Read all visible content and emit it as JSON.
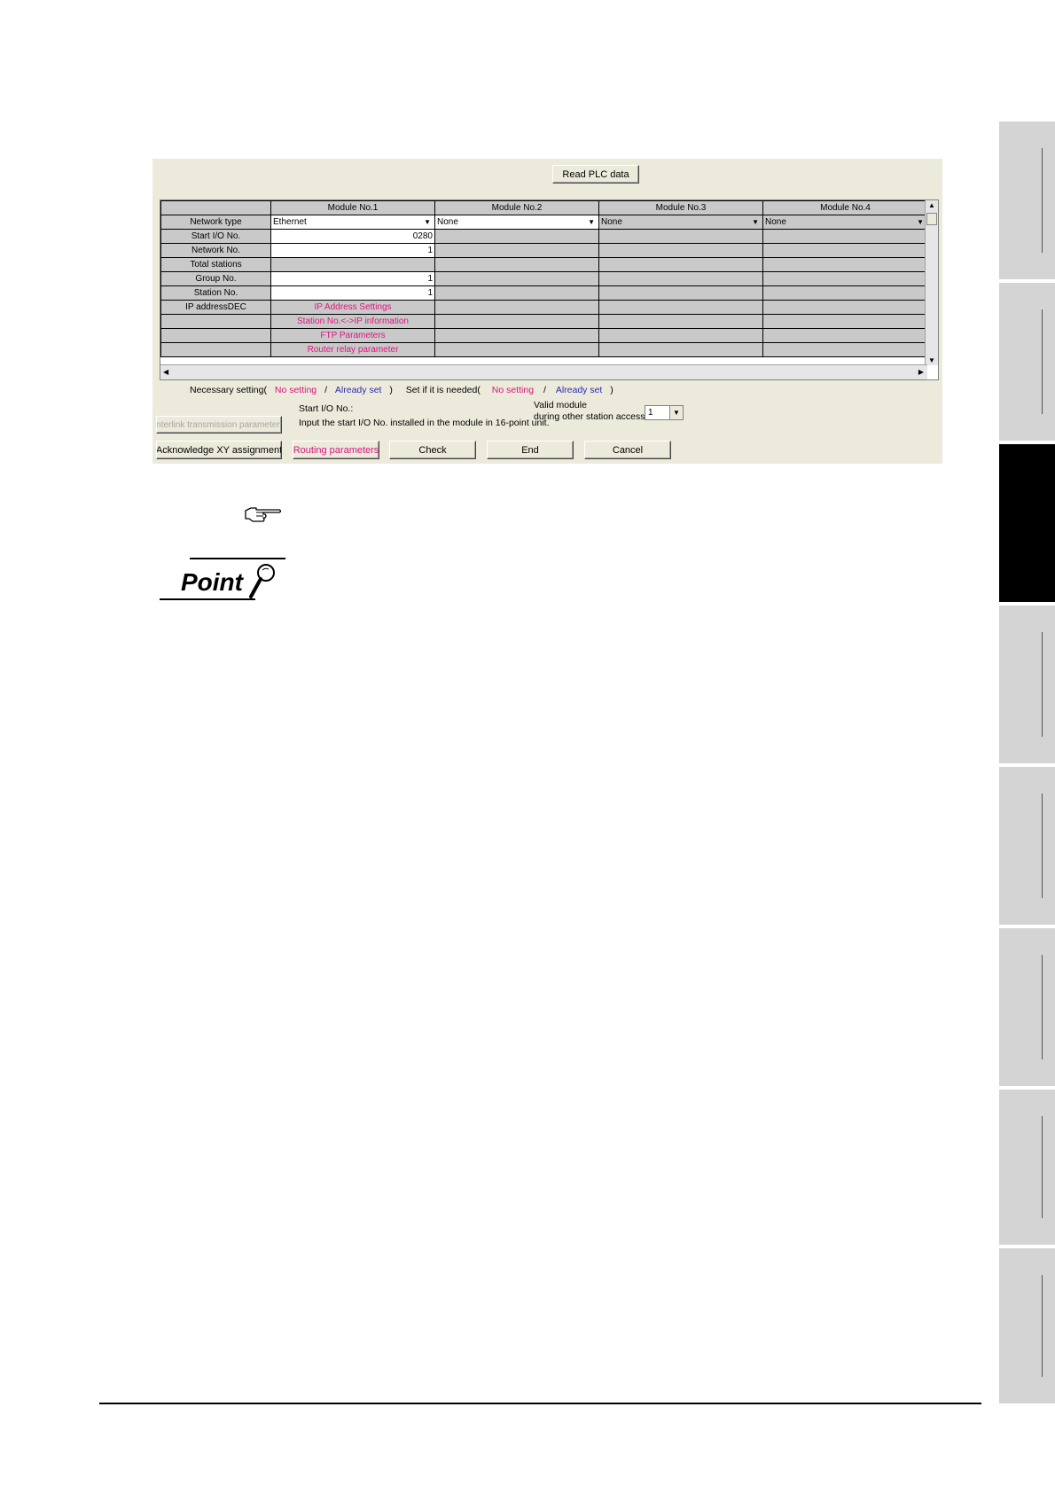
{
  "dialog": {
    "read_plc_button": "Read PLC data",
    "grid": {
      "columns": [
        "Module No.1",
        "Module No.2",
        "Module No.3",
        "Module No.4"
      ],
      "rows": {
        "network_type": {
          "label": "Network type",
          "values": [
            "Ethernet",
            "None",
            "None",
            "None"
          ]
        },
        "start_io": {
          "label": "Start I/O No.",
          "value": "0280"
        },
        "network_no": {
          "label": "Network No.",
          "value": "1"
        },
        "total_stations": {
          "label": "Total stations"
        },
        "group_no": {
          "label": "Group No.",
          "value": "1"
        },
        "station_no": {
          "label": "Station No.",
          "value": "1"
        },
        "ip_address": {
          "label": "IP addressDEC",
          "button": "IP Address Settings"
        },
        "station_ip": {
          "button": "Station No.<->IP information"
        },
        "ftp": {
          "button": "FTP Parameters"
        },
        "router": {
          "button": "Router relay parameter"
        }
      }
    },
    "legend": {
      "necessary_label": "Necessary setting(",
      "no_setting": "No setting",
      "slash": "/",
      "already_set": "Already set",
      "close": ")",
      "needed_label": "Set if it is needed(",
      "no_setting_2": "No setting",
      "slash_2": "/",
      "already_set_2": "Already set",
      "close_2": ")"
    },
    "hint": {
      "title": "Start I/O No.:",
      "text": "Input the start I/O No. installed in the module in 16-point unit."
    },
    "valid_module": {
      "line1": "Valid module",
      "line2": "during other station access",
      "value": "1"
    },
    "buttons": {
      "interlink": "Interlink transmission parameters",
      "acknowledge": "Acknowledge XY assignment",
      "routing": "Routing parameters",
      "check": "Check",
      "end": "End",
      "cancel": "Cancel"
    }
  },
  "point_logo_text": "Point",
  "colors": {
    "dialog_bg": "#ecebdb",
    "cell_gray": "#c9c9c9",
    "magenta": "#d6147f",
    "blue": "#2a2ab0",
    "side_tab": "#d4d4d4",
    "side_tab_active": "#000000"
  },
  "icons": [
    "pointing-hand-icon",
    "magnifier-icon",
    "dropdown-arrow-icon",
    "scroll-arrow-icon"
  ]
}
